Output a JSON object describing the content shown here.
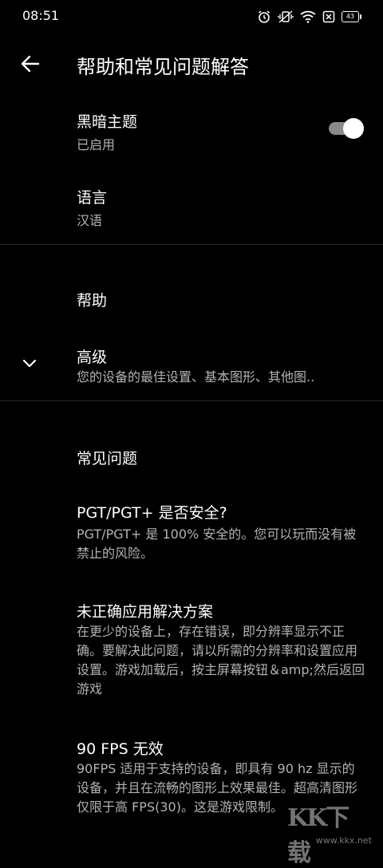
{
  "status_bar": {
    "time": "08:51",
    "battery": "43",
    "icons": [
      "alarm-icon",
      "vibrate-icon",
      "wifi-icon",
      "no-sim-icon",
      "battery-icon"
    ]
  },
  "app_bar": {
    "title": "帮助和常见问题解答",
    "back_icon": "arrow-left-icon"
  },
  "settings": {
    "dark_theme": {
      "title": "黑暗主题",
      "subtitle": "已启用",
      "enabled": true
    },
    "language": {
      "title": "语言",
      "subtitle": "汉语"
    },
    "help": {
      "title": "帮助"
    },
    "advanced": {
      "title": "高级",
      "subtitle": "您的设备的最佳设置、基本图形、其他图.."
    }
  },
  "faq": {
    "section_title": "常见问题",
    "items": [
      {
        "question": "PGT/PGT+ 是否安全?",
        "answer": "PGT/PGT+ 是 100% 安全的。您可以玩而没有被禁止的风险。"
      },
      {
        "question": "未正确应用解决方案",
        "answer": "在更少的设备上，存在错误，即分辨率显示不正确。要解决此问题，请以所需的分辨率和设置应用设置。游戏加载后，按主屏幕按钮＆amp;然后返回游戏"
      },
      {
        "question": "90 FPS 无效",
        "answer": "90FPS 适用于支持的设备，即具有 90 hz 显示的设备，并且在流畅的图形上效果最佳。超高清图形仅限于高 FPS(30)。这是游戏限制。"
      }
    ]
  },
  "watermark": {
    "logo": "KK下载",
    "url": "www.kkx.net"
  }
}
